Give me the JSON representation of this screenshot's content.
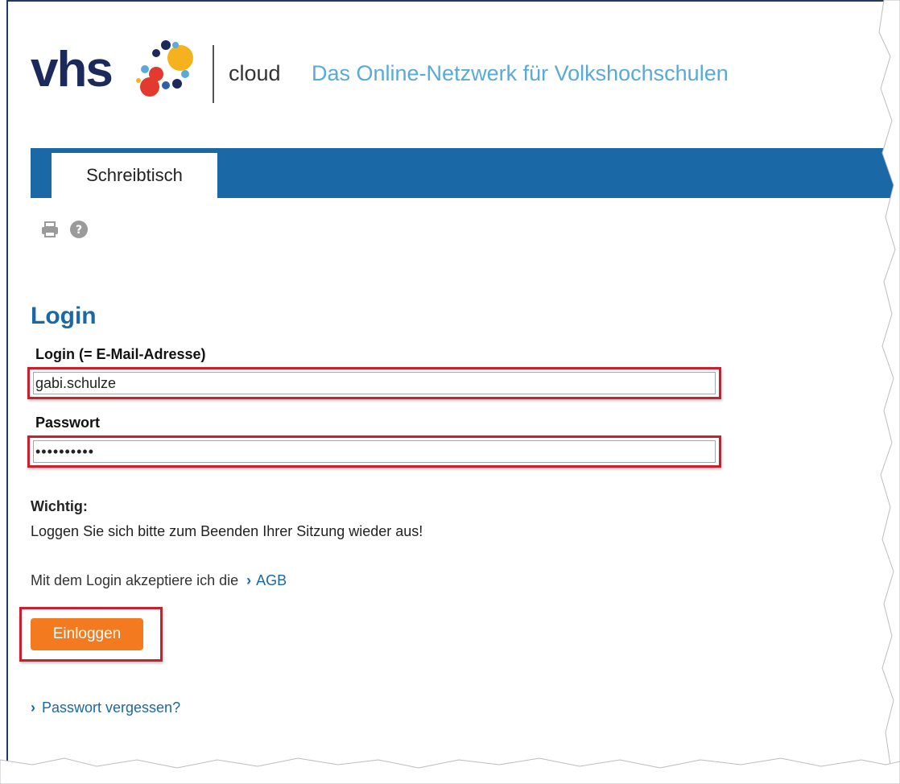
{
  "header": {
    "logo_text": "vhs",
    "product": "cloud",
    "tagline": "Das Online-Netzwerk für Volkshochschulen",
    "colors": {
      "logo": "#1b2a5a",
      "tagline": "#5aaad8"
    }
  },
  "nav": {
    "active_tab": "Schreibtisch",
    "bar_color": "#1a68a6"
  },
  "toolbar": {
    "icons": [
      "print-icon",
      "help-icon"
    ]
  },
  "login": {
    "title": "Login",
    "username_label": "Login (= E-Mail-Adresse)",
    "username_value": "gabi.schulze",
    "password_label": "Passwort",
    "password_value": "••••••••••",
    "important_title": "Wichtig:",
    "important_text": "Loggen Sie sich bitte zum Beenden Ihrer Sitzung wieder aus!",
    "agb_prefix": "Mit dem Login akzeptiere ich die",
    "agb_link": "AGB",
    "submit_label": "Einloggen",
    "forgot_link": "Passwort vergessen?",
    "colors": {
      "title": "#1a68a6",
      "button": "#f47a1f",
      "highlight": "#cc1f2d"
    }
  }
}
